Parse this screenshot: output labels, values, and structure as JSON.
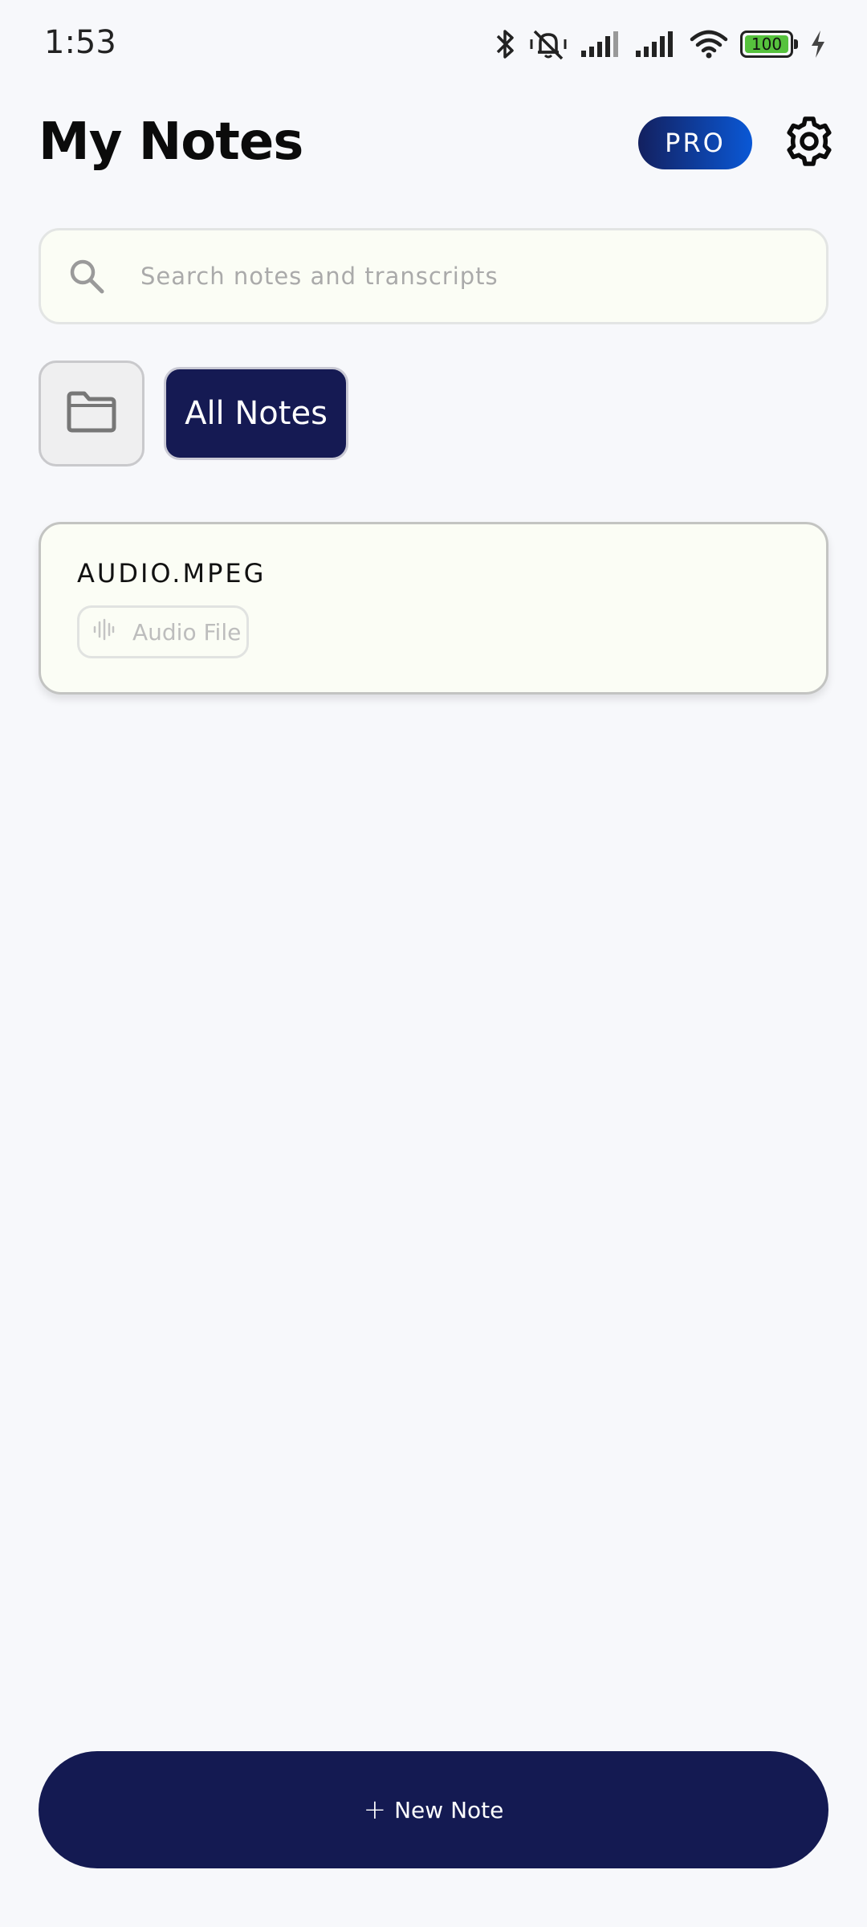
{
  "status_bar": {
    "time": "1:53",
    "battery_level": "100",
    "icons": [
      "bluetooth-icon",
      "silent-vibrate-icon",
      "signal-icon",
      "signal-icon",
      "wifi-icon",
      "battery-icon",
      "charging-icon"
    ]
  },
  "header": {
    "title": "My Notes",
    "pro_label": "PRO",
    "settings_icon": "gear-icon"
  },
  "search": {
    "placeholder": "Search notes and transcripts",
    "value": ""
  },
  "filters": {
    "folder_icon": "folder-icon",
    "active_label": "All Notes"
  },
  "notes": [
    {
      "title": "AUDIO.MPEG",
      "tag_label": "Audio File",
      "tag_icon": "audio-waveform-icon"
    }
  ],
  "footer": {
    "new_note_plus": "+",
    "new_note_label": "New Note"
  },
  "colors": {
    "background": "#f7f8fb",
    "primary_navy": "#141a52",
    "pro_gradient_start": "#13205f",
    "pro_gradient_end": "#0a58d6",
    "card_bg": "#fbfdf5",
    "battery_green": "#56c23d"
  }
}
